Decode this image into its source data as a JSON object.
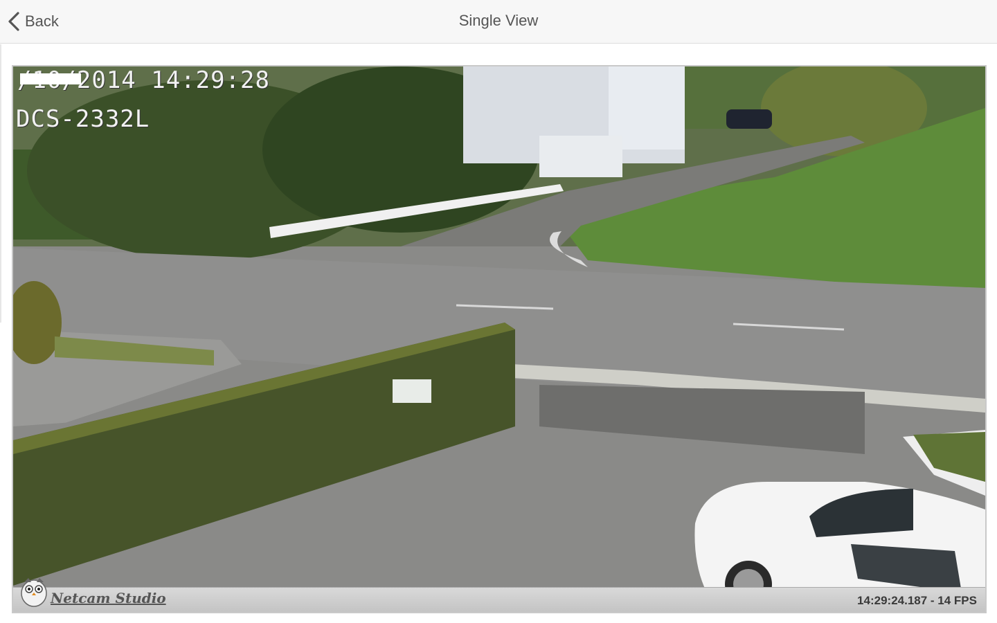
{
  "header": {
    "back_label": "Back",
    "title": "Single View"
  },
  "camera": {
    "osd_date": "  /10/2014  14:29:28",
    "osd_model": "DCS-2332L",
    "brand": "Netcam Studio",
    "stamp": "14:29:24.187 - 14 FPS"
  },
  "colors": {
    "header_bg": "#f7f7f7",
    "text": "#555555"
  }
}
